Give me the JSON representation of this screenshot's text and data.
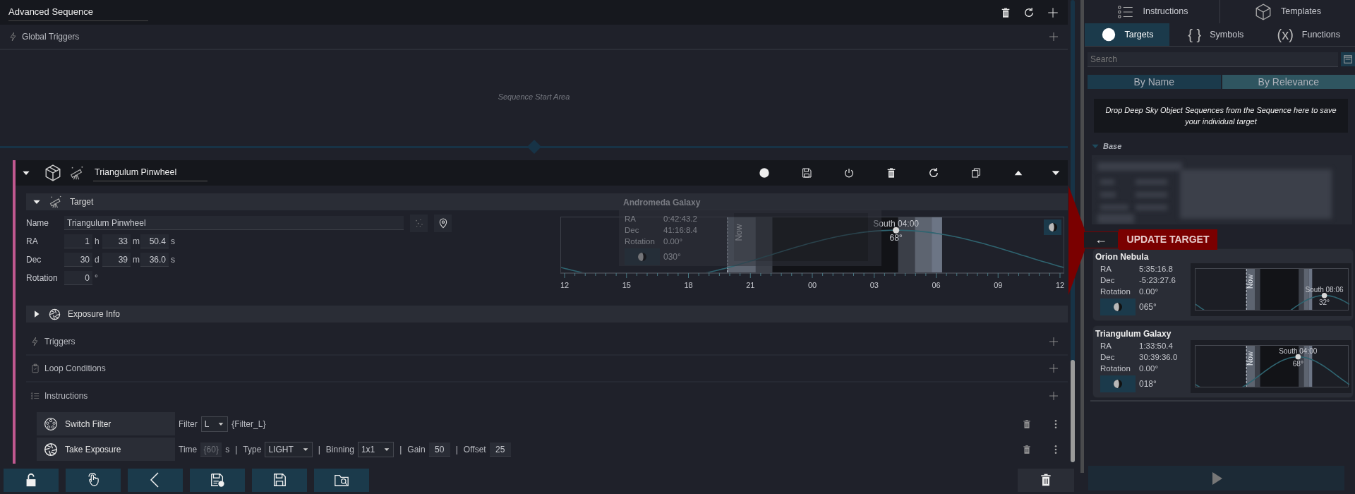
{
  "header": {
    "title": "Advanced Sequence"
  },
  "global_triggers": {
    "label": "Global Triggers"
  },
  "start_area": {
    "hint": "Sequence Start Area"
  },
  "target_block": {
    "title": "Triangulum Pinwheel",
    "expanded": true,
    "target": {
      "label": "Target",
      "expanded": true,
      "name_label": "Name",
      "name": "Triangulum Pinwheel",
      "coords": [
        {
          "label": "RA",
          "parts": [
            {
              "value": "1",
              "unit": "h"
            },
            {
              "value": "33",
              "unit": "m"
            },
            {
              "value": "50.4",
              "unit": "s"
            }
          ]
        },
        {
          "label": "Dec",
          "parts": [
            {
              "value": "30",
              "unit": "d"
            },
            {
              "value": "39",
              "unit": "m"
            },
            {
              "value": "36.0",
              "unit": "s"
            }
          ]
        },
        {
          "label": "Rotation",
          "parts": [
            {
              "value": "0",
              "unit": "°"
            }
          ]
        }
      ],
      "chart": {
        "now_label": "Now",
        "transit_label": "South 04:00",
        "altitude": "68°",
        "x_labels": [
          "12",
          "15",
          "18",
          "21",
          "00",
          "03",
          "06",
          "09",
          "12"
        ]
      }
    },
    "exposure_info": {
      "label": "Exposure Info",
      "expanded": false
    },
    "sections": [
      {
        "kind": "triggers",
        "label": "Triggers"
      },
      {
        "kind": "conditions",
        "label": "Loop Conditions"
      },
      {
        "kind": "instructions",
        "label": "Instructions"
      }
    ],
    "instructions": [
      {
        "kind": "filter",
        "name": "Switch Filter",
        "params": [
          {
            "kind": "label",
            "text": "Filter"
          },
          {
            "kind": "select",
            "text": "L"
          },
          {
            "kind": "label",
            "text": "{Filter_L}"
          }
        ]
      },
      {
        "kind": "exposure",
        "name": "Take Exposure",
        "params": [
          {
            "kind": "label",
            "text": "Time"
          },
          {
            "kind": "expr",
            "text": "{60}"
          },
          {
            "kind": "label",
            "text": "s"
          },
          {
            "kind": "sep",
            "text": "|"
          },
          {
            "kind": "label",
            "text": "Type"
          },
          {
            "kind": "select",
            "text": "LIGHT"
          },
          {
            "kind": "sep",
            "text": "|"
          },
          {
            "kind": "label",
            "text": "Binning"
          },
          {
            "kind": "select",
            "text": "1x1"
          },
          {
            "kind": "sep",
            "text": "|"
          },
          {
            "kind": "label",
            "text": "Gain"
          },
          {
            "kind": "input",
            "text": "50"
          },
          {
            "kind": "sep",
            "text": "|"
          },
          {
            "kind": "label",
            "text": "Offset"
          },
          {
            "kind": "input",
            "text": "25"
          }
        ]
      }
    ]
  },
  "drag_ghost": {
    "title": "Andromeda Galaxy",
    "fields": [
      {
        "label": "RA",
        "value": "0:42:43.2"
      },
      {
        "label": "Dec",
        "value": "41:16:8.4"
      },
      {
        "label": "Rotation",
        "value": "0.00°"
      }
    ],
    "moon_angle": "030°"
  },
  "drop_hint": {
    "arrow": "←",
    "label": "UPDATE TARGET"
  },
  "toolbar": [
    {
      "kind": "unlock"
    },
    {
      "kind": "touch"
    },
    {
      "kind": "back"
    },
    {
      "kind": "save-as"
    },
    {
      "kind": "save"
    },
    {
      "kind": "open"
    }
  ],
  "right_panel": {
    "top_tabs": [
      {
        "label": "Instructions",
        "kind": "instructions",
        "selected": false
      },
      {
        "label": "Templates",
        "kind": "templates",
        "selected": false
      }
    ],
    "tabs": [
      {
        "label": "Targets",
        "kind": "targets",
        "selected": true
      },
      {
        "label": "Symbols",
        "glyph": "{ }",
        "kind": "glyph",
        "selected": false
      },
      {
        "label": "Functions",
        "glyph": "(x)",
        "kind": "glyph",
        "selected": false
      }
    ],
    "search": {
      "placeholder": "Search"
    },
    "sort": [
      {
        "label": "By Name",
        "selected": false
      },
      {
        "label": "By Relevance",
        "selected": true
      }
    ],
    "drop_hint": "Drop Deep Sky Object Sequences from the Sequence here to save your individual target",
    "group": {
      "label": "Base",
      "expanded": true
    },
    "cards": [
      {
        "kind": "blurred"
      },
      {
        "kind": "target",
        "name": "Orion Nebula",
        "fields": [
          {
            "label": "RA",
            "value": "5:35:16.8"
          },
          {
            "label": "Dec",
            "value": "-5:23:27.6"
          },
          {
            "label": "Rotation",
            "value": "0.00°"
          }
        ],
        "moon_angle": "065°",
        "chart": {
          "now_label": "Now",
          "transit_label": "South 08:06",
          "altitude": "32°"
        }
      },
      {
        "kind": "target",
        "name": "Triangulum Galaxy",
        "fields": [
          {
            "label": "RA",
            "value": "1:33:50.4"
          },
          {
            "label": "Dec",
            "value": "30:39:36.0"
          },
          {
            "label": "Rotation",
            "value": "0.00°"
          }
        ],
        "moon_angle": "018°",
        "chart": {
          "now_label": "Now",
          "transit_label": "South 04:00",
          "altitude": "68°"
        }
      }
    ]
  }
}
